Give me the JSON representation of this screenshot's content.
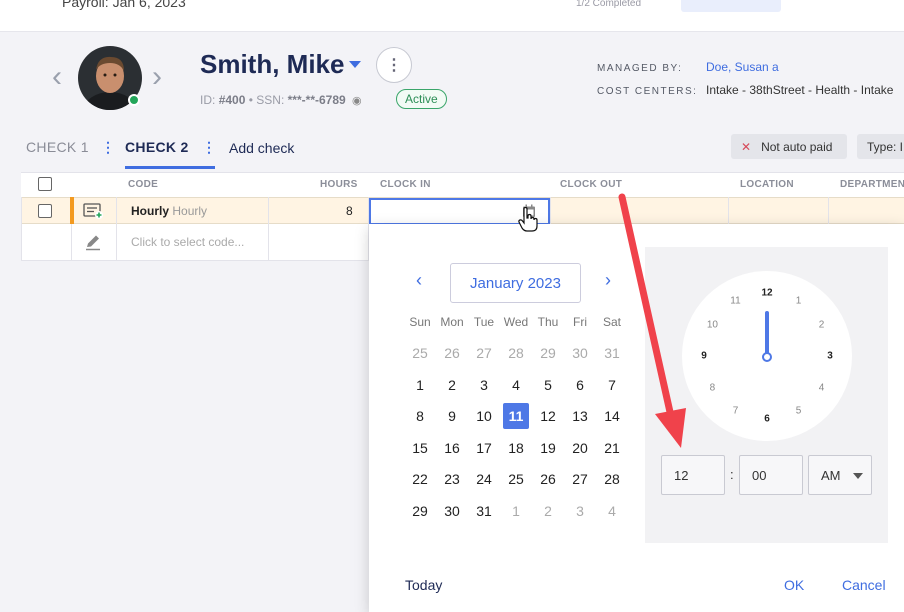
{
  "top_bar": {
    "payroll_label": "Payroll: Jan 6, 2023",
    "completed_label": "1/2 Completed"
  },
  "employee": {
    "name": "Smith, Mike",
    "id_label": "ID:",
    "id_value": "#400",
    "ssn_label": "SSN:",
    "ssn_value": "***-**-6789",
    "status": "Active",
    "managed_by_label": "MANAGED BY:",
    "managed_by_value": "Doe, Susan a",
    "cost_centers_label": "COST CENTERS:",
    "cost_centers_value": "Intake - 38thStreet - Health - Intake"
  },
  "tabs": [
    {
      "label": "CHECK 1"
    },
    {
      "label": "CHECK 2"
    }
  ],
  "add_check_label": "Add check",
  "chips": {
    "not_auto_paid": "Not auto paid",
    "type": "Type: I"
  },
  "table": {
    "headers": [
      "CODE",
      "HOURS",
      "CLOCK IN",
      "CLOCK OUT",
      "LOCATION",
      "DEPARTMENT"
    ],
    "row1": {
      "code_bold": "Hourly",
      "code_light": "Hourly",
      "hours": "8"
    },
    "row2": {
      "placeholder": "Click to select code..."
    }
  },
  "calendar": {
    "month_label": "January 2023",
    "weekdays": [
      "Sun",
      "Mon",
      "Tue",
      "Wed",
      "Thu",
      "Fri",
      "Sat"
    ],
    "weeks": [
      [
        "25",
        "26",
        "27",
        "28",
        "29",
        "30",
        "31"
      ],
      [
        "1",
        "2",
        "3",
        "4",
        "5",
        "6",
        "7"
      ],
      [
        "8",
        "9",
        "10",
        "11",
        "12",
        "13",
        "14"
      ],
      [
        "15",
        "16",
        "17",
        "18",
        "19",
        "20",
        "21"
      ],
      [
        "22",
        "23",
        "24",
        "25",
        "26",
        "27",
        "28"
      ],
      [
        "29",
        "30",
        "31",
        "1",
        "2",
        "3",
        "4"
      ]
    ],
    "selected_day": "11",
    "today_label": "Today",
    "ok_label": "OK",
    "cancel_label": "Cancel"
  },
  "clock": {
    "numbers": [
      "12",
      "1",
      "2",
      "3",
      "4",
      "5",
      "6",
      "7",
      "8",
      "9",
      "10",
      "11"
    ],
    "hour_value": "12",
    "minute_value": "00",
    "ampm_value": "AM"
  },
  "colors": {
    "accent": "#3f6de0",
    "active_green": "#2c8e56",
    "highlight_row": "#fff4e3",
    "annotation_arrow": "#f0424b"
  }
}
